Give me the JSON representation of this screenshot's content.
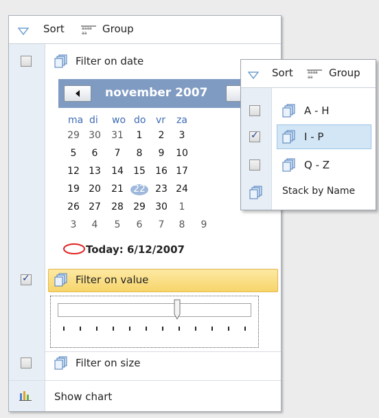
{
  "panel": {
    "header": {
      "sort_label": "Sort",
      "group_label": "Group"
    },
    "filters": [
      {
        "label": "Filter on date",
        "checked": false
      },
      {
        "label": "Filter on value",
        "checked": true
      },
      {
        "label": "Filter on size",
        "checked": false
      }
    ],
    "show_chart_label": "Show chart"
  },
  "calendar": {
    "month_title": "november 2007",
    "weekdays": [
      "ma",
      "di",
      "wo",
      "do",
      "vr",
      "za"
    ],
    "rows": [
      [
        "29",
        "30",
        "31",
        "1",
        "2",
        "3"
      ],
      [
        "5",
        "6",
        "7",
        "8",
        "9",
        "10"
      ],
      [
        "12",
        "13",
        "14",
        "15",
        "16",
        "17"
      ],
      [
        "19",
        "20",
        "21",
        "22",
        "23",
        "24"
      ],
      [
        "26",
        "27",
        "28",
        "29",
        "30",
        "1"
      ],
      [
        "3",
        "4",
        "5",
        "6",
        "7",
        "8",
        "9"
      ]
    ],
    "today_text": "Today: 6/12/2007"
  },
  "slider": {
    "value_fraction": 0.62,
    "tick_count": 12
  },
  "popup": {
    "header": {
      "sort_label": "Sort",
      "group_label": "Group"
    },
    "items": [
      {
        "label": "A - H",
        "checked": false
      },
      {
        "label": "I - P",
        "checked": true
      },
      {
        "label": "Q - Z",
        "checked": false
      }
    ],
    "stack_label": "Stack by Name"
  },
  "colors": {
    "accent_header": "#7f9bc2",
    "highlight": "#f7d56b",
    "selection": "#d3e6f6",
    "today_circle": "#9fb8dc",
    "today_marker": "#e02020"
  },
  "icons": [
    "triangle-down-icon",
    "group-icon",
    "stack-icon",
    "chart-icon",
    "arrow-left-icon"
  ]
}
